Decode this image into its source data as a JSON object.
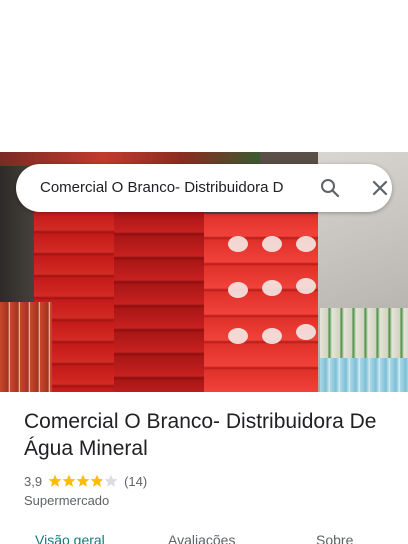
{
  "search": {
    "value": "Comercial O Branco- Distribuidora D"
  },
  "place": {
    "title": "Comercial O Branco- Distribuidora De Água Mineral",
    "rating_value": "3,9",
    "rating_stars": 3.9,
    "review_count": "(14)",
    "category": "Supermercado"
  },
  "tabs": [
    {
      "label": "Visão geral",
      "active": true
    },
    {
      "label": "Avaliações",
      "active": false
    },
    {
      "label": "Sobre",
      "active": false
    }
  ],
  "icons": {
    "search": "search-icon",
    "close": "close-icon",
    "star": "star-icon"
  },
  "colors": {
    "star_filled": "#fbbc04",
    "star_empty": "#dadce0",
    "active_tab": "#137a7f"
  }
}
